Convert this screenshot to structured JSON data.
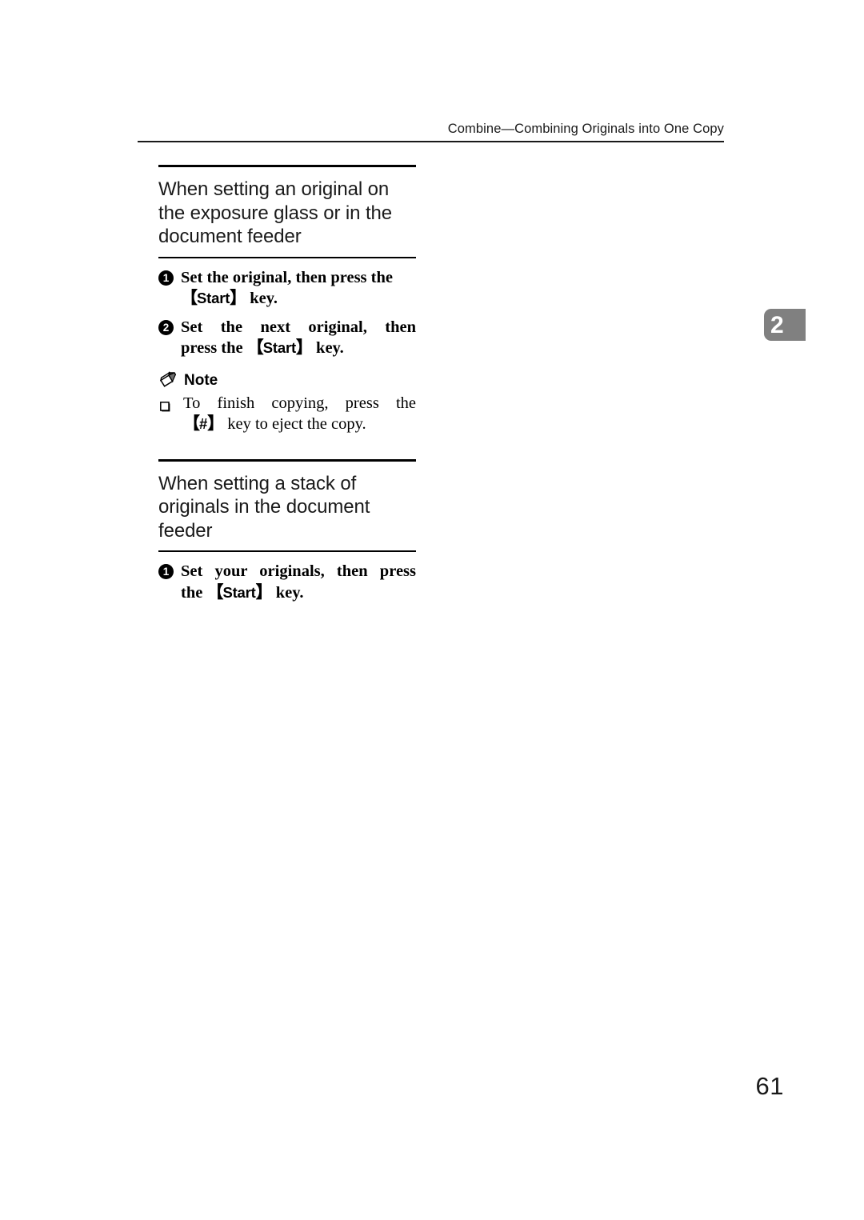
{
  "header": {
    "running_title": "Combine—Combining Originals into One Copy"
  },
  "chapter_tab": {
    "number": "2",
    "color": "#808080",
    "text_color": "#ffffff"
  },
  "folio": {
    "page_number": "61"
  },
  "sections": [
    {
      "heading": "When setting an original on the exposure glass or in the document feeder",
      "steps": [
        {
          "number": "1",
          "line_1": "Set the original, then press the",
          "key_open": "【",
          "key_label": "Start",
          "key_close": "】",
          "line_2_tail": " key."
        },
        {
          "number": "2",
          "line_1": "Set the next original, then",
          "line_2_head": "press the ",
          "key_open": "【",
          "key_label": "Start",
          "key_close": "】",
          "line_2_tail": " key."
        }
      ],
      "note": {
        "icon": "pencil-icon",
        "title": "Note",
        "items": [
          {
            "bullet": "hollow-square-bullet",
            "line_1": "To finish copying, press the",
            "key_open": "【",
            "key_label": "#",
            "key_close": "】",
            "line_2_tail": " key to eject the copy."
          }
        ]
      }
    },
    {
      "heading": "When setting a stack of originals in the document feeder",
      "steps": [
        {
          "number": "1",
          "line_1": "Set your originals, then press",
          "line_2_head": "the ",
          "key_open": "【",
          "key_label": "Start",
          "key_close": "】",
          "line_2_tail": " key."
        }
      ]
    }
  ]
}
